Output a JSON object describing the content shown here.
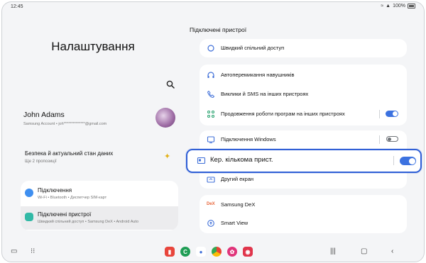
{
  "status": {
    "time": "12:45",
    "battery": "100%"
  },
  "left": {
    "title": "Налаштування",
    "profile": {
      "name": "John Adams",
      "subtitle": "Samsung Account  •  joh**************@gmail.com"
    },
    "security": {
      "title": "Безпека й актуальний стан даних",
      "subtitle": "Ще 2 пропозиції"
    },
    "items": [
      {
        "title": "Підключення",
        "subtitle": "Wi-Fi  •  Bluetooth  •  Диспетчер SIM-карт"
      },
      {
        "title": "Підключені пристрої",
        "subtitle": "Швидкий спільний доступ  •  Samsung DeX  •  Android Auto"
      }
    ]
  },
  "right": {
    "header": "Підключені пристрої",
    "quick_share": "Швидкий спільний доступ",
    "group2": [
      {
        "label": "Автоперемикання навушників"
      },
      {
        "label": "Виклики й SMS на інших пристроях"
      },
      {
        "label": "Продовження роботи програм на інших пристроях",
        "toggle": "on"
      }
    ],
    "windows": {
      "label": "Підключення Windows",
      "toggle": "off"
    },
    "multi_control": {
      "label": "Кер. кількома прист.",
      "toggle": "on"
    },
    "second_screen": "Другий екран",
    "dex": "Samsung DeX",
    "smart_view": "Smart View"
  },
  "colors": {
    "accent": "#3c72e0",
    "highlight_border": "#2f5fd6"
  }
}
